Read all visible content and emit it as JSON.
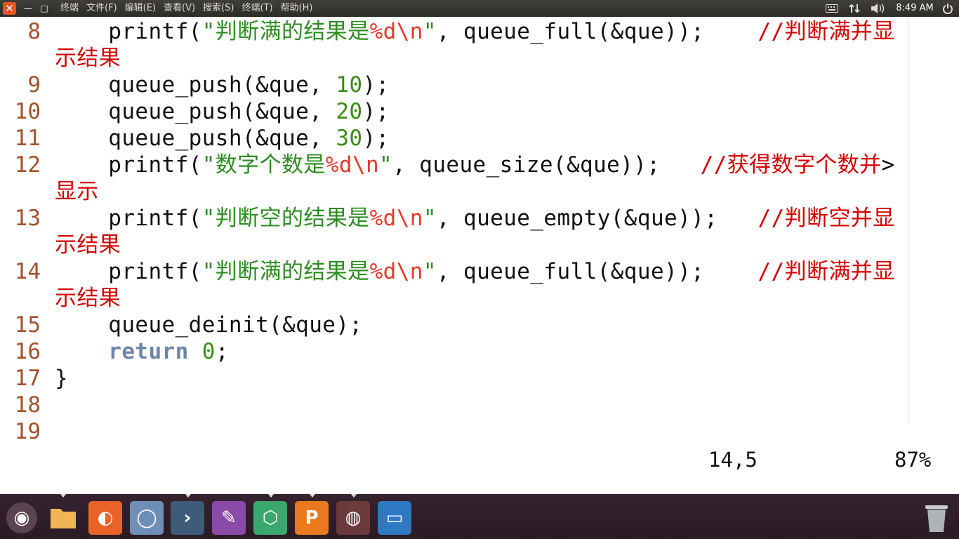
{
  "window": {
    "close_glyph": "✕",
    "minimize_glyph": "—",
    "maximize_glyph": "□"
  },
  "menubar": {
    "items": [
      "终端",
      "文件(F)",
      "编辑(E)",
      "查看(V)",
      "搜索(S)",
      "终端(T)",
      "帮助(H)"
    ]
  },
  "tray": {
    "keyboard_icon": "keyboard-icon",
    "network_icon": "network-icon",
    "volume_icon": "volume-icon",
    "time": "8:49 AM",
    "power_icon": "power-icon"
  },
  "editor": {
    "lines": [
      {
        "no": "8",
        "parts": [
          [
            "",
            "    printf("
          ],
          [
            "str",
            "\"判断满的结果是"
          ],
          [
            "fmt",
            "%d\\n"
          ],
          [
            "str",
            "\""
          ],
          [
            "",
            ", queue_full(&que));    "
          ],
          [
            "cmt",
            "//判断满并显"
          ]
        ]
      },
      {
        "no": "",
        "parts": [
          [
            "cmt",
            "示结果"
          ]
        ]
      },
      {
        "no": "9",
        "parts": [
          [
            "",
            "    queue_push(&que, "
          ],
          [
            "num",
            "10"
          ],
          [
            "",
            ");"
          ]
        ]
      },
      {
        "no": "10",
        "parts": [
          [
            "",
            "    queue_push(&que, "
          ],
          [
            "num",
            "20"
          ],
          [
            "",
            ");"
          ]
        ]
      },
      {
        "no": "11",
        "parts": [
          [
            "",
            "    queue_push(&que, "
          ],
          [
            "num",
            "30"
          ],
          [
            "",
            ");"
          ]
        ]
      },
      {
        "no": "12",
        "parts": [
          [
            "",
            "    printf("
          ],
          [
            "str",
            "\"数字个数是"
          ],
          [
            "fmt",
            "%d\\n"
          ],
          [
            "str",
            "\""
          ],
          [
            "",
            ", queue_size(&que));   "
          ],
          [
            "cmt",
            "//获得数字个数并"
          ],
          [
            "",
            ">"
          ]
        ]
      },
      {
        "no": "",
        "parts": [
          [
            "cmt",
            "显示"
          ]
        ]
      },
      {
        "no": "13",
        "parts": [
          [
            "",
            "    printf("
          ],
          [
            "str",
            "\"判断空的结果是"
          ],
          [
            "fmt",
            "%d\\n"
          ],
          [
            "str",
            "\""
          ],
          [
            "",
            ", queue_empty(&que));   "
          ],
          [
            "cmt",
            "//判断空并显"
          ]
        ]
      },
      {
        "no": "",
        "parts": [
          [
            "cmt",
            "示结果"
          ]
        ]
      },
      {
        "no": "14",
        "parts": [
          [
            "",
            "    printf("
          ],
          [
            "str",
            "\"判断满的结果是"
          ],
          [
            "fmt",
            "%d\\n"
          ],
          [
            "str",
            "\""
          ],
          [
            "",
            ", queue_full(&que));    "
          ],
          [
            "cmt",
            "//判断满并显"
          ]
        ]
      },
      {
        "no": "",
        "parts": [
          [
            "cmt",
            "示结果"
          ]
        ]
      },
      {
        "no": "15",
        "parts": [
          [
            "",
            "    queue_deinit(&que);"
          ]
        ]
      },
      {
        "no": "16",
        "parts": [
          [
            "",
            "    "
          ],
          [
            "kw",
            "return"
          ],
          [
            "",
            " "
          ],
          [
            "num",
            "0"
          ],
          [
            "",
            ";"
          ]
        ]
      },
      {
        "no": "17",
        "parts": [
          [
            "",
            "}"
          ]
        ]
      },
      {
        "no": "18",
        "parts": []
      },
      {
        "no": "19",
        "parts": []
      }
    ],
    "status_position": "14,5",
    "status_percent": "87%"
  },
  "dock": {
    "items": [
      {
        "name": "ubuntu-logo-icon",
        "glyph": "◉",
        "bg": "#5b4452"
      },
      {
        "name": "files-folder-icon",
        "glyph": "",
        "bg": "#e9a33a"
      },
      {
        "name": "firefox-icon",
        "glyph": "◐",
        "bg": "#e8622a"
      },
      {
        "name": "chromium-icon",
        "glyph": "◯",
        "bg": "#6f8fb8"
      },
      {
        "name": "terminal-icon",
        "glyph": "›",
        "bg": "#3e5c7a"
      },
      {
        "name": "text-editor-icon",
        "glyph": "✎",
        "bg": "#8a4aa8"
      },
      {
        "name": "package-icon",
        "glyph": "⬡",
        "bg": "#3aa86e"
      },
      {
        "name": "presentation-icon",
        "glyph": "P",
        "bg": "#e87a1d"
      },
      {
        "name": "paint-palette-icon",
        "glyph": "◍",
        "bg": "#6b3b3b"
      },
      {
        "name": "window-manager-icon",
        "glyph": "▭",
        "bg": "#2f78c4"
      },
      {
        "name": "trash-icon",
        "glyph": "",
        "bg": "#9aa0a6"
      }
    ]
  }
}
